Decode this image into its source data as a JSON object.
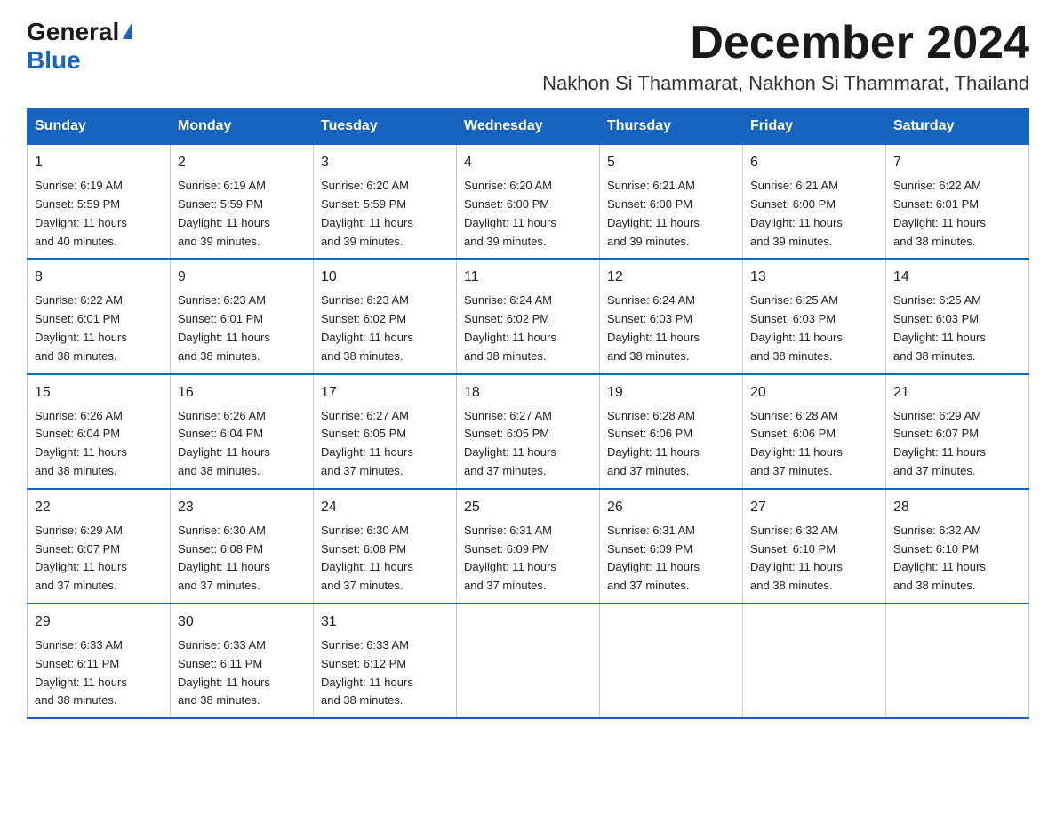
{
  "logo": {
    "general": "General",
    "triangle": "▶",
    "blue": "Blue"
  },
  "title": "December 2024",
  "location": "Nakhon Si Thammarat, Nakhon Si Thammarat, Thailand",
  "headers": [
    "Sunday",
    "Monday",
    "Tuesday",
    "Wednesday",
    "Thursday",
    "Friday",
    "Saturday"
  ],
  "weeks": [
    [
      {
        "day": "1",
        "sunrise": "6:19 AM",
        "sunset": "5:59 PM",
        "daylight": "11 hours and 40 minutes."
      },
      {
        "day": "2",
        "sunrise": "6:19 AM",
        "sunset": "5:59 PM",
        "daylight": "11 hours and 39 minutes."
      },
      {
        "day": "3",
        "sunrise": "6:20 AM",
        "sunset": "5:59 PM",
        "daylight": "11 hours and 39 minutes."
      },
      {
        "day": "4",
        "sunrise": "6:20 AM",
        "sunset": "6:00 PM",
        "daylight": "11 hours and 39 minutes."
      },
      {
        "day": "5",
        "sunrise": "6:21 AM",
        "sunset": "6:00 PM",
        "daylight": "11 hours and 39 minutes."
      },
      {
        "day": "6",
        "sunrise": "6:21 AM",
        "sunset": "6:00 PM",
        "daylight": "11 hours and 39 minutes."
      },
      {
        "day": "7",
        "sunrise": "6:22 AM",
        "sunset": "6:01 PM",
        "daylight": "11 hours and 38 minutes."
      }
    ],
    [
      {
        "day": "8",
        "sunrise": "6:22 AM",
        "sunset": "6:01 PM",
        "daylight": "11 hours and 38 minutes."
      },
      {
        "day": "9",
        "sunrise": "6:23 AM",
        "sunset": "6:01 PM",
        "daylight": "11 hours and 38 minutes."
      },
      {
        "day": "10",
        "sunrise": "6:23 AM",
        "sunset": "6:02 PM",
        "daylight": "11 hours and 38 minutes."
      },
      {
        "day": "11",
        "sunrise": "6:24 AM",
        "sunset": "6:02 PM",
        "daylight": "11 hours and 38 minutes."
      },
      {
        "day": "12",
        "sunrise": "6:24 AM",
        "sunset": "6:03 PM",
        "daylight": "11 hours and 38 minutes."
      },
      {
        "day": "13",
        "sunrise": "6:25 AM",
        "sunset": "6:03 PM",
        "daylight": "11 hours and 38 minutes."
      },
      {
        "day": "14",
        "sunrise": "6:25 AM",
        "sunset": "6:03 PM",
        "daylight": "11 hours and 38 minutes."
      }
    ],
    [
      {
        "day": "15",
        "sunrise": "6:26 AM",
        "sunset": "6:04 PM",
        "daylight": "11 hours and 38 minutes."
      },
      {
        "day": "16",
        "sunrise": "6:26 AM",
        "sunset": "6:04 PM",
        "daylight": "11 hours and 38 minutes."
      },
      {
        "day": "17",
        "sunrise": "6:27 AM",
        "sunset": "6:05 PM",
        "daylight": "11 hours and 37 minutes."
      },
      {
        "day": "18",
        "sunrise": "6:27 AM",
        "sunset": "6:05 PM",
        "daylight": "11 hours and 37 minutes."
      },
      {
        "day": "19",
        "sunrise": "6:28 AM",
        "sunset": "6:06 PM",
        "daylight": "11 hours and 37 minutes."
      },
      {
        "day": "20",
        "sunrise": "6:28 AM",
        "sunset": "6:06 PM",
        "daylight": "11 hours and 37 minutes."
      },
      {
        "day": "21",
        "sunrise": "6:29 AM",
        "sunset": "6:07 PM",
        "daylight": "11 hours and 37 minutes."
      }
    ],
    [
      {
        "day": "22",
        "sunrise": "6:29 AM",
        "sunset": "6:07 PM",
        "daylight": "11 hours and 37 minutes."
      },
      {
        "day": "23",
        "sunrise": "6:30 AM",
        "sunset": "6:08 PM",
        "daylight": "11 hours and 37 minutes."
      },
      {
        "day": "24",
        "sunrise": "6:30 AM",
        "sunset": "6:08 PM",
        "daylight": "11 hours and 37 minutes."
      },
      {
        "day": "25",
        "sunrise": "6:31 AM",
        "sunset": "6:09 PM",
        "daylight": "11 hours and 37 minutes."
      },
      {
        "day": "26",
        "sunrise": "6:31 AM",
        "sunset": "6:09 PM",
        "daylight": "11 hours and 37 minutes."
      },
      {
        "day": "27",
        "sunrise": "6:32 AM",
        "sunset": "6:10 PM",
        "daylight": "11 hours and 38 minutes."
      },
      {
        "day": "28",
        "sunrise": "6:32 AM",
        "sunset": "6:10 PM",
        "daylight": "11 hours and 38 minutes."
      }
    ],
    [
      {
        "day": "29",
        "sunrise": "6:33 AM",
        "sunset": "6:11 PM",
        "daylight": "11 hours and 38 minutes."
      },
      {
        "day": "30",
        "sunrise": "6:33 AM",
        "sunset": "6:11 PM",
        "daylight": "11 hours and 38 minutes."
      },
      {
        "day": "31",
        "sunrise": "6:33 AM",
        "sunset": "6:12 PM",
        "daylight": "11 hours and 38 minutes."
      },
      null,
      null,
      null,
      null
    ]
  ],
  "sunrise_label": "Sunrise: ",
  "sunset_label": "Sunset: ",
  "daylight_label": "Daylight: "
}
